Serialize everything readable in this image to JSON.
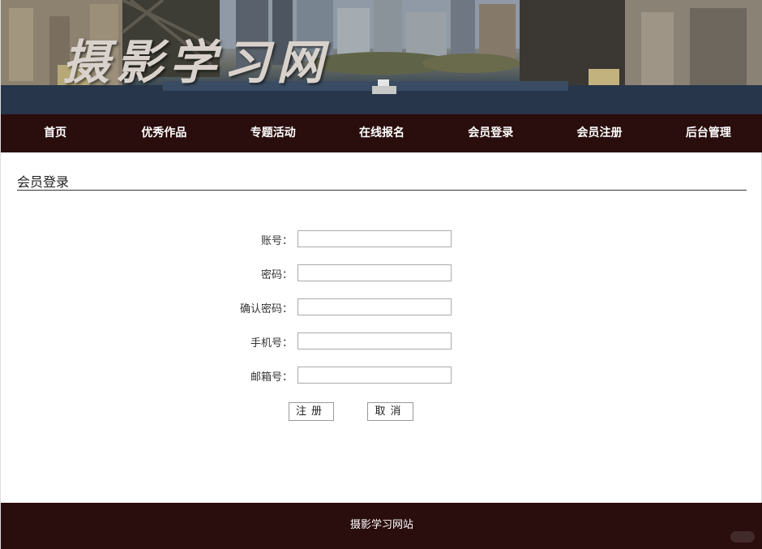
{
  "banner": {
    "title": "摄影学习网"
  },
  "nav": {
    "items": [
      {
        "label": "首页"
      },
      {
        "label": "优秀作品"
      },
      {
        "label": "专题活动"
      },
      {
        "label": "在线报名"
      },
      {
        "label": "会员登录"
      },
      {
        "label": "会员注册"
      },
      {
        "label": "后台管理"
      }
    ]
  },
  "section": {
    "title": "会员登录"
  },
  "form": {
    "fields": [
      {
        "label": "账号：",
        "value": "",
        "placeholder": ""
      },
      {
        "label": "密码：",
        "value": "",
        "placeholder": ""
      },
      {
        "label": "确认密码：",
        "value": "",
        "placeholder": ""
      },
      {
        "label": "手机号：",
        "value": "",
        "placeholder": ""
      },
      {
        "label": "邮箱号：",
        "value": "",
        "placeholder": ""
      }
    ],
    "register_label": "注册",
    "cancel_label": "取消"
  },
  "footer": {
    "text": "摄影学习网站"
  },
  "colors": {
    "nav_bg": "#2a0d0d",
    "footer_bg": "#2a0d0d",
    "nav_text": "#ffffff"
  },
  "icons": {
    "banner_image": "city-river-photo"
  }
}
